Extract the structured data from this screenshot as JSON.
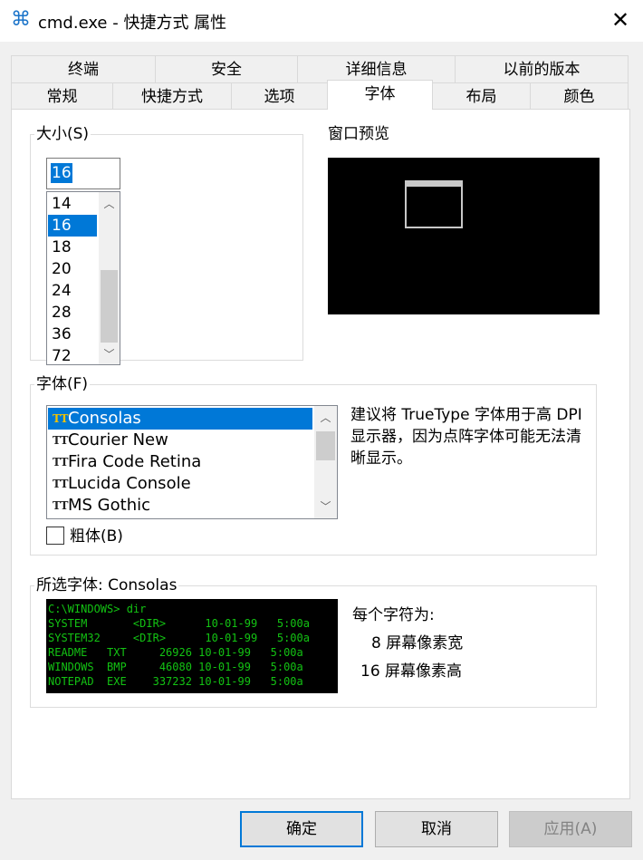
{
  "window": {
    "title": "cmd.exe - 快捷方式 属性",
    "app_icon": "⌘",
    "close_glyph": "✕"
  },
  "tabs": {
    "row1": [
      "终端",
      "安全",
      "详细信息",
      "以前的版本"
    ],
    "row2": [
      "常规",
      "快捷方式",
      "选项",
      "字体",
      "布局",
      "颜色"
    ],
    "active": "字体"
  },
  "size_group": {
    "label": "大小(S)",
    "value": "16",
    "items": [
      "14",
      "16",
      "18",
      "20",
      "24",
      "28",
      "36",
      "72"
    ],
    "selected": "16"
  },
  "preview": {
    "label": "窗口预览"
  },
  "font_group": {
    "label": "字体(F)",
    "items": [
      "Consolas",
      "Courier New",
      "Fira Code Retina",
      "Lucida Console",
      "MS Gothic"
    ],
    "selected": "Consolas",
    "note": "建议将 TrueType 字体用于高 DPI 显示器，因为点阵字体可能无法清晰显示。",
    "bold_label": "粗体(B)",
    "bold_checked": false
  },
  "selected_font": {
    "label": "所选字体: Consolas",
    "sample_lines": [
      "C:\\WINDOWS> dir",
      "SYSTEM       <DIR>      10-01-99   5:00a",
      "SYSTEM32     <DIR>      10-01-99   5:00a",
      "README   TXT     26926 10-01-99   5:00a",
      "WINDOWS  BMP     46080 10-01-99   5:00a",
      "NOTEPAD  EXE    337232 10-01-99   5:00a"
    ],
    "char_label": "每个字符为:",
    "width_text": "8 屏幕像素宽",
    "height_text": "16 屏幕像素高"
  },
  "buttons": {
    "ok": "确定",
    "cancel": "取消",
    "apply": "应用(A)"
  },
  "colors": {
    "accent": "#0078d7",
    "sample_text": "#13c313"
  }
}
